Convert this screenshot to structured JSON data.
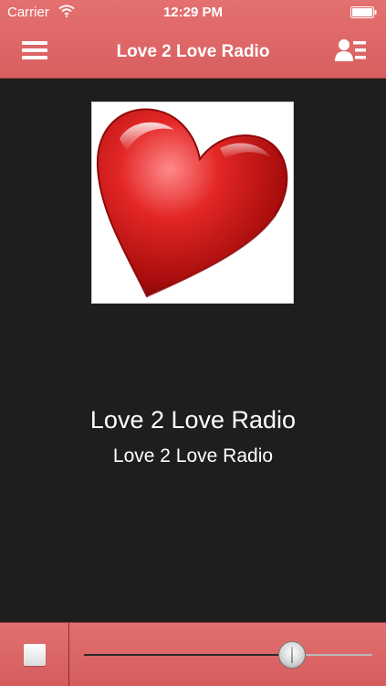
{
  "status_bar": {
    "carrier": "Carrier",
    "time": "12:29 PM",
    "wifi_icon": "wifi-icon",
    "battery_icon": "battery-icon"
  },
  "nav_bar": {
    "title": "Love 2 Love Radio",
    "menu_icon": "hamburger-menu-icon",
    "contacts_icon": "contact-list-icon",
    "color": "#de6666"
  },
  "now_playing": {
    "artwork_icon": "heart-icon",
    "title": "Love 2 Love Radio",
    "subtitle": "Love 2 Love Radio"
  },
  "player_controls": {
    "stop_icon": "stop-icon",
    "volume_level": 0.72,
    "accent_color": "#de6666"
  }
}
